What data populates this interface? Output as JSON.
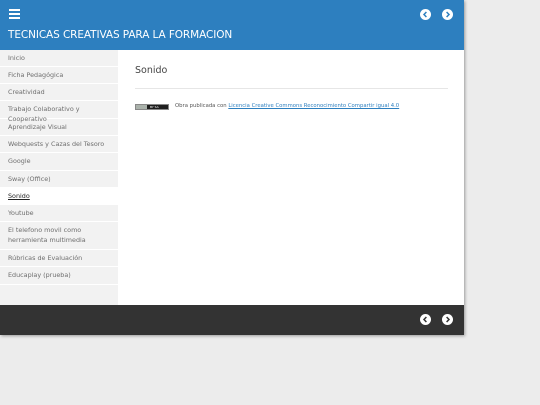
{
  "header": {
    "title": "TECNICAS CREATIVAS PARA LA FORMACION",
    "menu_icon": "hamburger-icon",
    "prev_icon": "chevron-left-circle-icon",
    "next_icon": "chevron-right-circle-icon"
  },
  "sidebar": {
    "items": [
      {
        "label": "Inicio",
        "active": false
      },
      {
        "label": "Ficha Pedagógica",
        "active": false
      },
      {
        "label": "Creatividad",
        "active": false
      },
      {
        "label": "Trabajo Colaborativo y Cooperativo",
        "active": false
      },
      {
        "label": "Aprendizaje Visual",
        "active": false
      },
      {
        "label": "Webquests y Cazas del Tesoro",
        "active": false
      },
      {
        "label": "Google",
        "active": false
      },
      {
        "label": "Sway (Office)",
        "active": false
      },
      {
        "label": "Sonido",
        "active": true
      },
      {
        "label": "Youtube",
        "active": false
      },
      {
        "label": "El telefono movil como herramienta multimedia",
        "active": false
      },
      {
        "label": "Rúbricas de Evaluación",
        "active": false
      },
      {
        "label": "Educaplay (prueba)",
        "active": false
      }
    ]
  },
  "main": {
    "page_title": "Sonido",
    "license_prefix": "Obra publicada con",
    "license_link": "Licencia Creative Commons Reconocimiento Compartir igual 4.0",
    "badge_text": "BY SA"
  },
  "colors": {
    "header_bg": "#2d7fbf",
    "footer_bg": "#333333",
    "sidebar_bg": "#f2f2f2"
  }
}
